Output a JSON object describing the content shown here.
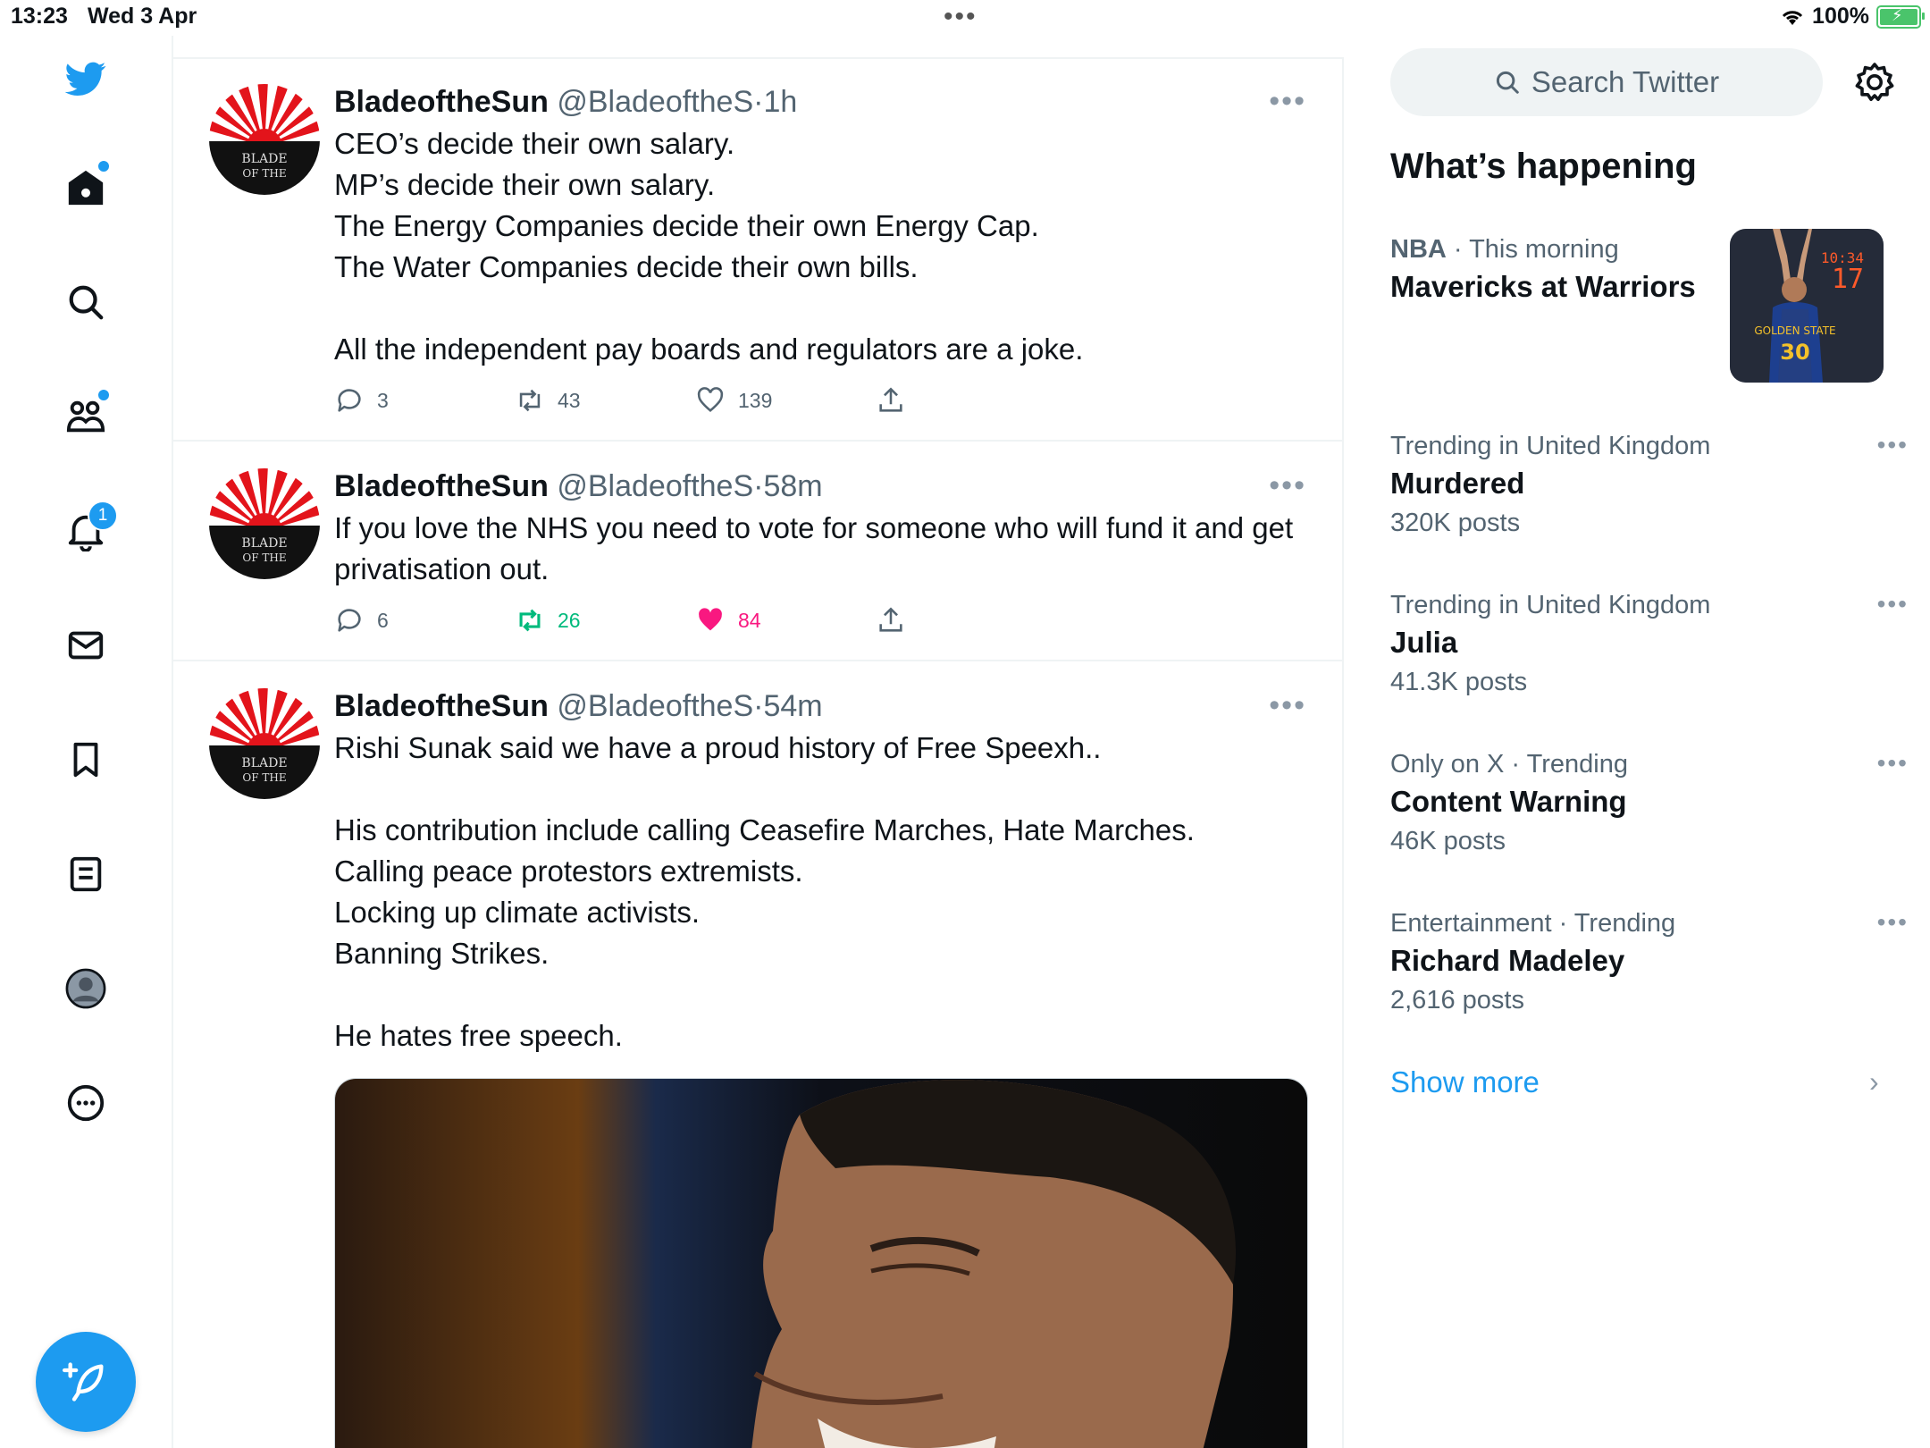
{
  "status_bar": {
    "time": "13:23",
    "date": "Wed 3 Apr",
    "battery": "100%"
  },
  "nav": {
    "items": [
      "home",
      "search",
      "communities",
      "notifications",
      "messages",
      "bookmarks",
      "lists",
      "profile",
      "more"
    ],
    "notifications_badge": "1"
  },
  "tweets": [
    {
      "name": "BladeoftheSun",
      "handle": "@BladeoftheS",
      "sep": "·",
      "time": "1h",
      "text": "CEO’s decide their own salary.\nMP’s decide their own salary.\nThe Energy Companies decide their own Energy Cap.\nThe Water Companies decide their own bills.\n\nAll the independent pay boards and regulators are a joke.",
      "replies": "3",
      "retweets": "43",
      "likes": "139",
      "retweeted": false,
      "liked": false
    },
    {
      "name": "BladeoftheSun",
      "handle": "@BladeoftheS",
      "sep": "·",
      "time": "58m",
      "text": "If you love the NHS you need to vote for someone who will fund it and get privatisation out.",
      "replies": "6",
      "retweets": "26",
      "likes": "84",
      "retweeted": true,
      "liked": true
    },
    {
      "name": "BladeoftheSun",
      "handle": "@BladeoftheS",
      "sep": "·",
      "time": "54m",
      "text": "Rishi Sunak said we have a proud history of Free Speexh..\n\nHis contribution include calling Ceasefire Marches, Hate Marches.\nCalling peace protestors extremists.\nLocking up climate activists.\nBanning Strikes.\n\nHe hates free speech.",
      "has_media": true
    }
  ],
  "right": {
    "search_placeholder": "Search Twitter",
    "heading": "What’s happening",
    "featured": {
      "category": "NBA",
      "sep": " · ",
      "when": "This morning",
      "title": "Mavericks at Warriors"
    },
    "trends": [
      {
        "meta": "Trending in United Kingdom",
        "name": "Murdered",
        "count": "320K posts"
      },
      {
        "meta": "Trending in United Kingdom",
        "name": "Julia",
        "count": "41.3K posts"
      },
      {
        "meta": "Only on X · Trending",
        "name": "Content Warning",
        "count": "46K posts"
      },
      {
        "meta": "Entertainment · Trending",
        "name": "Richard Madeley",
        "count": "2,616 posts"
      }
    ],
    "show_more": "Show more"
  },
  "colors": {
    "accent": "#1d9bf0",
    "retweet": "#00ba7c",
    "like": "#f91880",
    "muted": "#536471"
  }
}
